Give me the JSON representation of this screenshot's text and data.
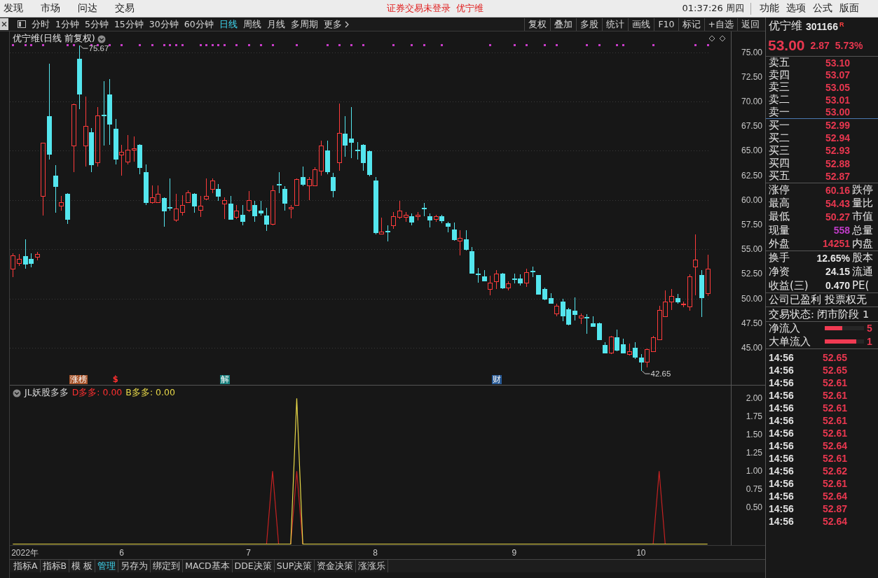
{
  "menu_bar": {
    "menus": [
      "发现",
      "市场",
      "问达",
      "交易"
    ],
    "status": "证券交易未登录",
    "stock": "优宁维",
    "clock": "01:37:26 周四",
    "right_menus": [
      "功能",
      "选项",
      "公式",
      "版面"
    ]
  },
  "toolbar": {
    "periods": [
      {
        "label": "分时",
        "selected": false
      },
      {
        "label": "1分钟",
        "selected": false
      },
      {
        "label": "5分钟",
        "selected": false
      },
      {
        "label": "15分钟",
        "selected": false
      },
      {
        "label": "30分钟",
        "selected": false
      },
      {
        "label": "60分钟",
        "selected": false
      },
      {
        "label": "日线",
        "selected": true
      },
      {
        "label": "周线",
        "selected": false
      },
      {
        "label": "月线",
        "selected": false
      },
      {
        "label": "多周期",
        "selected": false
      }
    ],
    "more": "更多",
    "tools": [
      "复权",
      "叠加",
      "多股",
      "统计",
      "画线",
      "F10",
      "标记",
      "+自选",
      "返回"
    ]
  },
  "price_pane": {
    "chart_data": [
      {
        "type": "candlestick",
        "title": "优宁维(日线 前复权)",
        "ylim": [
          41.2,
          77.1
        ],
        "grid": true,
        "yticks": [
          {
            "value": 75,
            "label": "75.00"
          },
          {
            "value": 72.5,
            "label": "72.50"
          },
          {
            "value": 70,
            "label": "70.00"
          },
          {
            "value": 67.5,
            "label": "67.50"
          },
          {
            "value": 65,
            "label": "65.00"
          },
          {
            "value": 62.5,
            "label": "62.50"
          },
          {
            "value": 60,
            "label": "60.00"
          },
          {
            "value": 57.5,
            "label": "57.50"
          },
          {
            "value": 55,
            "label": "55.00"
          },
          {
            "value": 52.5,
            "label": "52.50"
          },
          {
            "value": 50,
            "label": "50.00"
          },
          {
            "value": 47.5,
            "label": "47.50"
          },
          {
            "value": 45,
            "label": "45.00"
          }
        ],
        "ohlc": [
          [
            53.0,
            54.6,
            52.2,
            54.4
          ],
          [
            53.6,
            54.5,
            53.3,
            54.0
          ],
          [
            54.3,
            56.0,
            53.0,
            53.5
          ],
          [
            54.0,
            54.6,
            53.2,
            53.6
          ],
          [
            54.2,
            54.7,
            53.9,
            54.5
          ],
          [
            60.4,
            65.8,
            58.4,
            65.8
          ],
          [
            68.5,
            73.8,
            64.1,
            64.7
          ],
          [
            62.5,
            63.5,
            58.7,
            61.4
          ],
          [
            59.4,
            60.4,
            58.9,
            59.8
          ],
          [
            60.6,
            60.7,
            57.6,
            58.1
          ],
          [
            65.5,
            69.8,
            62.8,
            69.7
          ],
          [
            74.3,
            75.67,
            69.2,
            70.8
          ],
          [
            65.5,
            70.5,
            63.4,
            67.5
          ],
          [
            66.9,
            67.3,
            62.8,
            63.6
          ],
          [
            63.8,
            69.4,
            63.4,
            68.6
          ],
          [
            68.65,
            72.05,
            65.5,
            68.6
          ],
          [
            70.7,
            72.3,
            65.6,
            67.7
          ],
          [
            67.2,
            68.2,
            63.6,
            64.2
          ],
          [
            64.6,
            65.6,
            62.5,
            64.9
          ],
          [
            63.9,
            66.6,
            63.6,
            65.1
          ],
          [
            65.1,
            66.45,
            63.9,
            65.25
          ],
          [
            65.6,
            65.7,
            62.6,
            63.3
          ],
          [
            62.8,
            63.6,
            59.5,
            59.75
          ],
          [
            59.75,
            61.5,
            59.6,
            60.3
          ],
          [
            59.75,
            61.5,
            59.7,
            60.6
          ],
          [
            60.2,
            60.3,
            57.3,
            58.9
          ],
          [
            59.3,
            62.2,
            58.9,
            59.2
          ],
          [
            58.0,
            60.6,
            57.8,
            59.1
          ],
          [
            58.8,
            60.5,
            58.4,
            59.5
          ],
          [
            59.8,
            61.0,
            59.7,
            60.8
          ],
          [
            60.6,
            60.7,
            58.7,
            59.4
          ],
          [
            59.0,
            60.4,
            58.25,
            59.4
          ],
          [
            60.1,
            62.2,
            60.0,
            60.4
          ],
          [
            61.1,
            62.2,
            60.7,
            62.0
          ],
          [
            61.1,
            61.6,
            59.9,
            60.4
          ],
          [
            59.6,
            60.3,
            58.1,
            60.0
          ],
          [
            59.6,
            60.4,
            58.0,
            58.1
          ],
          [
            58.3,
            59.5,
            58.1,
            58.9
          ],
          [
            58.5,
            59.5,
            57.4,
            57.85
          ],
          [
            59.0,
            60.9,
            58.8,
            60.0
          ],
          [
            59.5,
            59.9,
            57.8,
            58.4
          ],
          [
            58.9,
            59.9,
            58.4,
            58.7
          ],
          [
            58.4,
            59.2,
            56.84,
            57.6
          ],
          [
            57.6,
            61.5,
            57.4,
            61.0
          ],
          [
            61.65,
            62.8,
            60.7,
            61.6
          ],
          [
            61.1,
            61.4,
            58.9,
            59.7
          ],
          [
            59.15,
            59.5,
            58.15,
            59.25
          ],
          [
            59.5,
            62.2,
            59.4,
            62.15
          ],
          [
            62.35,
            63.4,
            61.4,
            61.65
          ],
          [
            61.45,
            62.3,
            60.0,
            62.15
          ],
          [
            61.5,
            63.3,
            61.4,
            63.1
          ],
          [
            63.0,
            66.05,
            62.5,
            65.5
          ],
          [
            65.0,
            66.05,
            62.6,
            62.9
          ],
          [
            62.35,
            62.75,
            60.3,
            61.0
          ],
          [
            63.85,
            69.8,
            63.0,
            66.8
          ],
          [
            66.7,
            68.5,
            64.4,
            65.6
          ],
          [
            66.2,
            69.45,
            64.27,
            65.9
          ],
          [
            65.1,
            65.9,
            64.1,
            65.05
          ],
          [
            65.6,
            65.7,
            63.0,
            63.85
          ],
          [
            64.95,
            65.0,
            62.4,
            62.6
          ],
          [
            62.0,
            62.3,
            56.5,
            56.7
          ],
          [
            56.6,
            58.2,
            56.5,
            56.8
          ],
          [
            56.85,
            57.4,
            55.8,
            56.8
          ],
          [
            57.45,
            58.76,
            57.1,
            58.35
          ],
          [
            58.25,
            59.9,
            58.1,
            58.9
          ],
          [
            58.25,
            58.8,
            57.8,
            58.5
          ],
          [
            58.36,
            58.6,
            57.4,
            57.8
          ],
          [
            58.36,
            58.76,
            57.9,
            58.5
          ],
          [
            59.2,
            59.7,
            58.36,
            59.15
          ],
          [
            58.36,
            58.6,
            57.2,
            58.0
          ],
          [
            58.1,
            58.5,
            57.8,
            58.36
          ],
          [
            58.36,
            58.5,
            57.66,
            57.9
          ],
          [
            57.66,
            57.8,
            56.7,
            57.37
          ],
          [
            57.0,
            57.7,
            55.9,
            56.0
          ],
          [
            55.87,
            56.96,
            54.4,
            56.14
          ],
          [
            56.0,
            56.96,
            54.9,
            55.04
          ],
          [
            54.77,
            55.2,
            52.5,
            52.6
          ],
          [
            52.52,
            53.13,
            51.63,
            52.48
          ],
          [
            52.23,
            52.86,
            51.76,
            51.85
          ],
          [
            50.94,
            52.33,
            50.3,
            51.63
          ],
          [
            51.76,
            52.86,
            50.94,
            52.5
          ],
          [
            52.5,
            52.6,
            50.94,
            51.08
          ],
          [
            51.08,
            51.76,
            50.8,
            51.5
          ],
          [
            52.04,
            52.5,
            51.5,
            52.0
          ],
          [
            52.04,
            52.45,
            51.3,
            51.63
          ],
          [
            51.63,
            53.0,
            51.2,
            52.65
          ],
          [
            52.78,
            53.27,
            52.2,
            52.75
          ],
          [
            52.36,
            52.4,
            50.4,
            50.45
          ],
          [
            50.94,
            51.13,
            49.85,
            49.98
          ],
          [
            50.05,
            50.52,
            49.5,
            49.58
          ],
          [
            48.5,
            49.5,
            48.2,
            49.23
          ],
          [
            49.72,
            49.98,
            47.67,
            48.3
          ],
          [
            48.9,
            49.03,
            47.3,
            47.4
          ],
          [
            48.76,
            50.12,
            47.8,
            48.4
          ],
          [
            48.08,
            48.5,
            47.4,
            48.3
          ],
          [
            48.15,
            48.4,
            46.43,
            48.1
          ],
          [
            47.47,
            48.2,
            47.1,
            47.2
          ],
          [
            47.47,
            47.58,
            45.8,
            45.83
          ],
          [
            45.29,
            45.56,
            44.47,
            44.52
          ],
          [
            44.52,
            46.2,
            44.38,
            46.16
          ],
          [
            46.1,
            46.86,
            44.65,
            44.79
          ],
          [
            45.34,
            45.89,
            44.5,
            44.52
          ],
          [
            44.38,
            45.4,
            44.25,
            44.65
          ],
          [
            45.0,
            45.56,
            43.83,
            44.1
          ],
          [
            44.02,
            44.38,
            42.65,
            43.56
          ],
          [
            43.56,
            44.94,
            43.0,
            44.85
          ],
          [
            44.65,
            46.2,
            44.58,
            46.1
          ],
          [
            45.83,
            49.23,
            45.8,
            48.85
          ],
          [
            48.2,
            50.8,
            48.13,
            49.67
          ],
          [
            49.67,
            50.94,
            48.85,
            50.27
          ],
          [
            50.05,
            50.5,
            49.5,
            49.67
          ],
          [
            49.42,
            49.72,
            49.1,
            49.46
          ],
          [
            49.17,
            52.45,
            48.76,
            52.23
          ],
          [
            53.27,
            56.5,
            50.3,
            53.96
          ],
          [
            52.36,
            52.86,
            48.1,
            50.13
          ],
          [
            50.53,
            54.43,
            50.27,
            53.0
          ]
        ]
      }
    ],
    "high_callout": "75.67",
    "low_callout": "42.65",
    "event_tags": [
      {
        "label": "涨榜",
        "kind": "badge",
        "color": "#a8542a"
      },
      {
        "label": "$",
        "kind": "text",
        "color": "#ff3030"
      },
      {
        "label": "解",
        "kind": "badge",
        "color": "#16807e"
      },
      {
        "label": "财",
        "kind": "badge",
        "color": "#285a96"
      }
    ]
  },
  "indicator_pane": {
    "chart_data": [
      {
        "type": "line",
        "title": "JL妖股多多",
        "ylim": [
          0,
          2.18
        ],
        "yticks": [
          {
            "value": 2,
            "label": "2.00"
          },
          {
            "value": 1.75,
            "label": "1.75"
          },
          {
            "value": 1.5,
            "label": "1.50"
          },
          {
            "value": 1.25,
            "label": "1.25"
          },
          {
            "value": 1,
            "label": "1.00"
          },
          {
            "value": 0.75,
            "label": "0.75"
          },
          {
            "value": 0.5,
            "label": "0.50"
          }
        ],
        "categories": [
          null,
          null,
          "2022年",
          null,
          null,
          null,
          null,
          null,
          null,
          null,
          null,
          null,
          null,
          null,
          null,
          null,
          null,
          null,
          "6",
          null,
          null,
          null,
          null,
          null,
          null,
          null,
          null,
          null,
          null,
          null,
          null,
          null,
          null,
          null,
          null,
          null,
          null,
          null,
          null,
          "7",
          null,
          null,
          null,
          null,
          null,
          null,
          null,
          null,
          null,
          null,
          null,
          null,
          null,
          null,
          null,
          null,
          null,
          null,
          null,
          null,
          "8",
          null,
          null,
          null,
          null,
          null,
          null,
          null,
          null,
          null,
          null,
          null,
          null,
          null,
          null,
          null,
          null,
          null,
          null,
          null,
          null,
          null,
          null,
          "9",
          null,
          null,
          null,
          null,
          null,
          null,
          null,
          null,
          null,
          null,
          null,
          null,
          null,
          null,
          null,
          null,
          null,
          null,
          null,
          null,
          "10",
          null,
          null,
          null,
          null,
          null,
          null,
          null,
          null,
          null,
          null,
          null
        ],
        "series": [
          {
            "color": "#c42222",
            "values": [
              null,
              null,
              null,
              null,
              null,
              null,
              null,
              null,
              null,
              null,
              null,
              null,
              null,
              null,
              null,
              null,
              null,
              null,
              null,
              null,
              null,
              null,
              null,
              null,
              null,
              null,
              null,
              null,
              null,
              null,
              null,
              null,
              null,
              null,
              null,
              null,
              null,
              null,
              null,
              null,
              null,
              null,
              0,
              1,
              0,
              null,
              0,
              1,
              0,
              null,
              null,
              null,
              null,
              null,
              null,
              null,
              null,
              null,
              null,
              null,
              null,
              null,
              null,
              null,
              null,
              null,
              null,
              null,
              null,
              null,
              null,
              null,
              null,
              null,
              null,
              null,
              null,
              null,
              null,
              null,
              null,
              null,
              null,
              null,
              null,
              null,
              null,
              null,
              null,
              null,
              null,
              null,
              null,
              null,
              null,
              null,
              null,
              null,
              null,
              null,
              null,
              null,
              null,
              null,
              null,
              null,
              0,
              1,
              0,
              null,
              null,
              null,
              null,
              null,
              null,
              null
            ]
          },
          {
            "color": "#e8d848",
            "values": [
              0,
              0,
              0,
              0,
              0,
              0,
              0,
              0,
              0,
              0,
              0,
              0,
              0,
              0,
              0,
              0,
              0,
              0,
              0,
              0,
              0,
              0,
              0,
              0,
              0,
              0,
              0,
              0,
              0,
              0,
              0,
              0,
              0,
              0,
              0,
              0,
              0,
              0,
              0,
              0,
              0,
              0,
              0,
              0,
              0,
              0,
              0,
              2,
              0,
              0,
              0,
              0,
              0,
              0,
              0,
              0,
              0,
              0,
              0,
              0,
              0,
              0,
              0,
              0,
              0,
              0,
              0,
              0,
              0,
              0,
              0,
              0,
              0,
              0,
              0,
              0,
              0,
              0,
              0,
              0,
              0,
              0,
              0,
              0,
              0,
              0,
              0,
              0,
              0,
              0,
              0,
              0,
              0,
              0,
              0,
              0,
              0,
              0,
              0,
              0,
              0,
              0,
              0,
              0,
              0,
              0,
              0,
              0,
              0,
              0,
              0,
              0,
              0,
              0,
              0,
              0
            ]
          }
        ]
      }
    ],
    "legend": [
      {
        "text": "D多多: 0.00",
        "color": "#ff3030"
      },
      {
        "text": "B多多: 0.00",
        "color": "#e8d848"
      }
    ]
  },
  "bottom_tabs": [
    {
      "label": "指标A",
      "selected": false
    },
    {
      "label": "指标B",
      "selected": false
    },
    {
      "label": "模 板",
      "selected": false
    },
    {
      "label": "管理",
      "selected": true
    },
    {
      "label": "另存为",
      "selected": false
    },
    {
      "label": "绑定到",
      "selected": false
    },
    {
      "label": "MACD基本",
      "selected": false
    },
    {
      "label": "DDE决策",
      "selected": false
    },
    {
      "label": "SUP决策",
      "selected": false
    },
    {
      "label": "资金决策",
      "selected": false
    },
    {
      "label": "涨涨乐",
      "selected": false
    }
  ],
  "quote_panel": {
    "name": "优宁维",
    "code": "301166",
    "badge": "R",
    "price": "53.00",
    "change": "2.87",
    "change_pct": "5.73%",
    "asks": [
      {
        "label": "卖五",
        "price": "53.10"
      },
      {
        "label": "卖四",
        "price": "53.07"
      },
      {
        "label": "卖三",
        "price": "53.05"
      },
      {
        "label": "卖二",
        "price": "53.01"
      },
      {
        "label": "卖一",
        "price": "53.00"
      }
    ],
    "bids": [
      {
        "label": "买一",
        "price": "52.99"
      },
      {
        "label": "买二",
        "price": "52.94"
      },
      {
        "label": "买三",
        "price": "52.93"
      },
      {
        "label": "买四",
        "price": "52.88"
      },
      {
        "label": "买五",
        "price": "52.87"
      }
    ],
    "stats": [
      {
        "label": "涨停",
        "value": "60.16",
        "color": "#e8374f",
        "next_label": "跌停"
      },
      {
        "label": "最高",
        "value": "54.43",
        "color": "#e8374f",
        "next_label": "量比"
      },
      {
        "label": "最低",
        "value": "50.27",
        "color": "#e8374f",
        "next_label": "市值"
      },
      {
        "label": "现量",
        "value": "558",
        "color": "#c03cc8",
        "next_label": "总量"
      },
      {
        "label": "外盘",
        "value": "14251",
        "color": "#e8374f",
        "next_label": "内盘"
      }
    ],
    "fundamentals": [
      {
        "label": "换手",
        "value": "12.65%",
        "next_label": "股本"
      },
      {
        "label": "净资",
        "value": "24.15",
        "next_label": "流通"
      },
      {
        "label": "收益(三)",
        "value": "0.470",
        "next_label": "PE("
      }
    ],
    "notes": [
      "公司已盈利 投票权无",
      "交易状态: 闭市阶段 1"
    ],
    "flows": [
      {
        "label": "净流入",
        "level": 0.45,
        "value": "5"
      },
      {
        "label": "大单流入",
        "level": 0.8,
        "value": "1"
      }
    ],
    "ticks": [
      {
        "time": "14:56",
        "price": "52.65"
      },
      {
        "time": "14:56",
        "price": "52.65"
      },
      {
        "time": "14:56",
        "price": "52.61"
      },
      {
        "time": "14:56",
        "price": "52.61"
      },
      {
        "time": "14:56",
        "price": "52.61"
      },
      {
        "time": "14:56",
        "price": "52.61"
      },
      {
        "time": "14:56",
        "price": "52.61"
      },
      {
        "time": "14:56",
        "price": "52.64"
      },
      {
        "time": "14:56",
        "price": "52.61"
      },
      {
        "time": "14:56",
        "price": "52.62"
      },
      {
        "time": "14:56",
        "price": "52.61"
      },
      {
        "time": "14:56",
        "price": "52.64"
      },
      {
        "time": "14:56",
        "price": "52.87"
      },
      {
        "time": "14:56",
        "price": "52.64"
      }
    ]
  }
}
